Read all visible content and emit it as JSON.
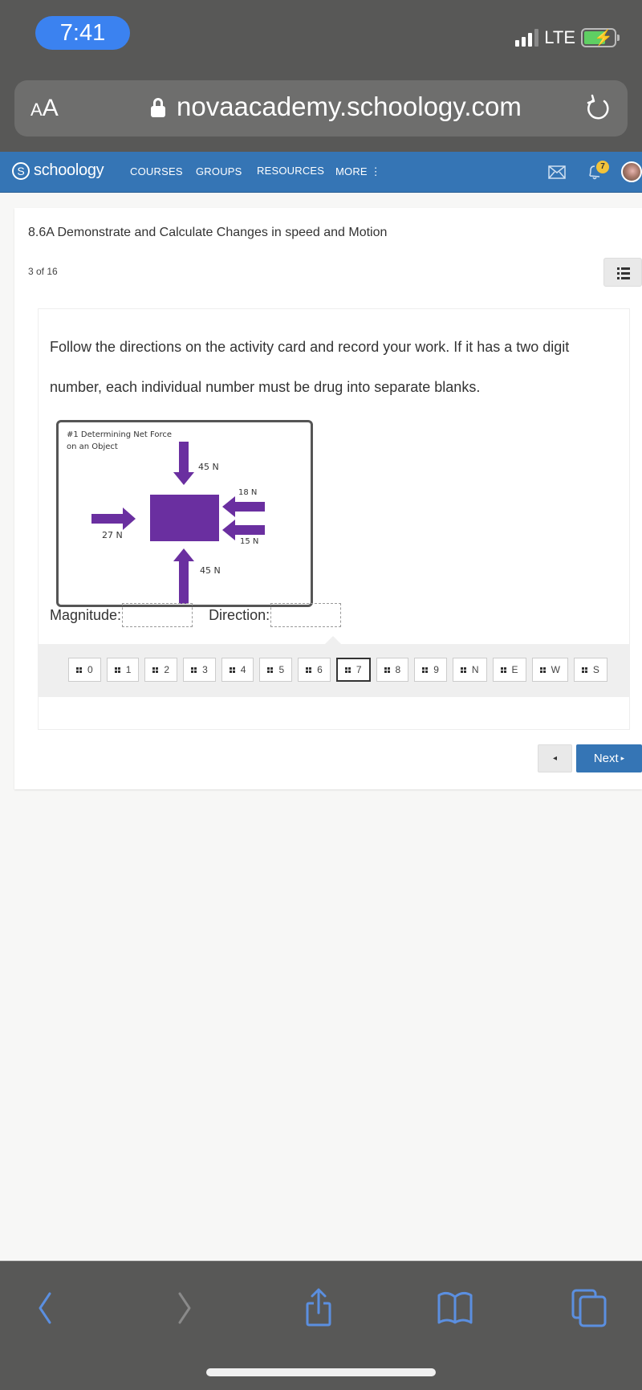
{
  "status_bar": {
    "time": "7:41",
    "network": "LTE"
  },
  "browser": {
    "text_size_label": "AA",
    "url": "novaacademy.schoology.com"
  },
  "nav": {
    "brand": "schoology",
    "items": [
      "COURSES",
      "GROUPS",
      "RESOURCES",
      "MORE"
    ],
    "notification_count": "7"
  },
  "page": {
    "title": "8.6A Demonstrate and Calculate Changes in speed and Motion",
    "position": "3 of 16"
  },
  "question": {
    "prompt": "Follow the directions on the activity card and record your work.  If it has a two digit number, each individual number must be drug into separate blanks.",
    "activity_card": {
      "title": "#1  Determining Net Force on an Object",
      "forces": [
        {
          "label": "45 N",
          "direction": "down"
        },
        {
          "label": "18 N",
          "direction": "left"
        },
        {
          "label": "27 N",
          "direction": "right"
        },
        {
          "label": "15 N",
          "direction": "left"
        },
        {
          "label": "45 N",
          "direction": "up"
        }
      ],
      "object_color": "#6a2fa0"
    },
    "magnitude_label": "Magnitude:",
    "direction_label": "Direction:",
    "magnitude_value": "",
    "direction_value": ""
  },
  "word_bank": {
    "options": [
      "0",
      "1",
      "2",
      "3",
      "4",
      "5",
      "6",
      "7",
      "8",
      "9",
      "N",
      "E",
      "W",
      "S"
    ],
    "selected": "7"
  },
  "navigation": {
    "prev_icon": "◂",
    "next_label": "Next",
    "next_icon": "▸"
  },
  "colors": {
    "brand_blue": "#3575b5",
    "ios_accent": "#5b8fe0",
    "badge": "#f2c33a"
  }
}
